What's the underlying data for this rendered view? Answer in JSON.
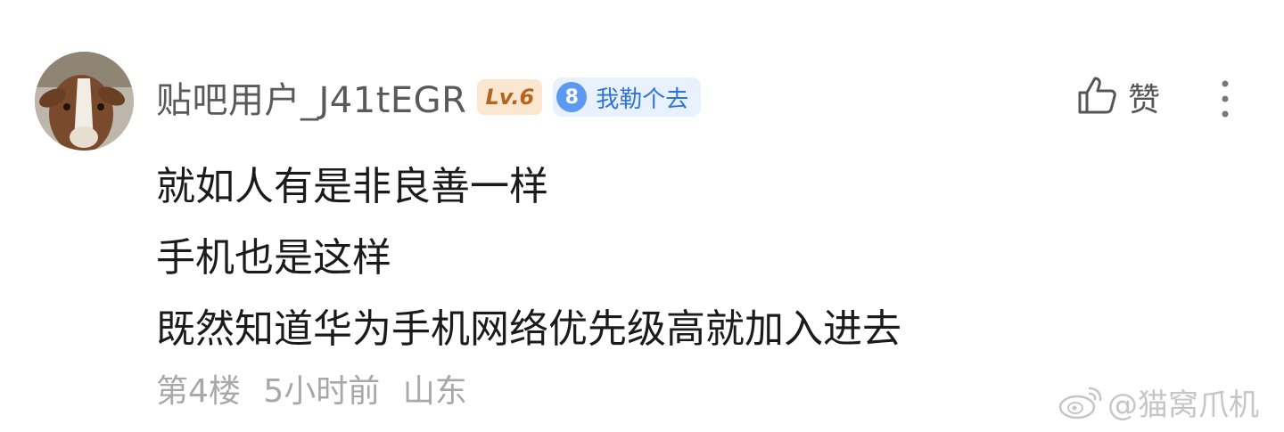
{
  "comment": {
    "user": {
      "name": "贴吧用户_J41tEGR",
      "level": "Lv.6",
      "group_level": "8",
      "group_name": "我勒个去"
    },
    "actions": {
      "like_label": "赞",
      "like_icon": "thumbs-up-icon",
      "more_icon": "more-vertical-icon"
    },
    "body_lines": [
      "就如人有是非良善一样",
      "手机也是这样",
      "既然知道华为手机网络优先级高就加入进去"
    ],
    "meta": {
      "floor": "第4楼",
      "time": "5小时前",
      "location": "山东"
    }
  },
  "watermark": {
    "text": "@猫窝爪机",
    "icon": "weibo-icon"
  },
  "colors": {
    "username": "#5a5a5a",
    "level_badge_bg": "#fbe6cf",
    "level_badge_text": "#b4651e",
    "group_badge_bg": "#e8f1fd",
    "group_badge_num": "#5b9af0",
    "group_badge_text": "#2f74d8",
    "body_text": "#1b1b1b",
    "meta_text": "#a8a8a8"
  }
}
